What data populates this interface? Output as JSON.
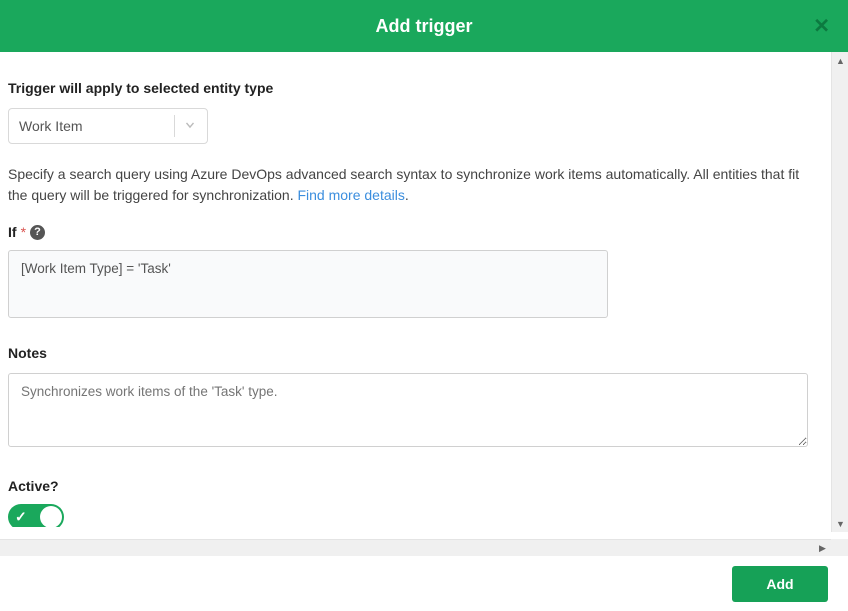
{
  "header": {
    "title": "Add trigger"
  },
  "entityType": {
    "label": "Trigger will apply to selected entity type",
    "selected": "Work Item"
  },
  "description": {
    "text": "Specify a search query using Azure DevOps advanced search syntax to synchronize work items automatically. All entities that fit the query will be triggered for synchronization. ",
    "linkText": "Find more details"
  },
  "ifField": {
    "label": "If",
    "value": "[Work Item Type] = 'Task'"
  },
  "notes": {
    "label": "Notes",
    "placeholder": "Synchronizes work items of the 'Task' type."
  },
  "active": {
    "label": "Active?",
    "value": true
  },
  "footer": {
    "addLabel": "Add"
  }
}
